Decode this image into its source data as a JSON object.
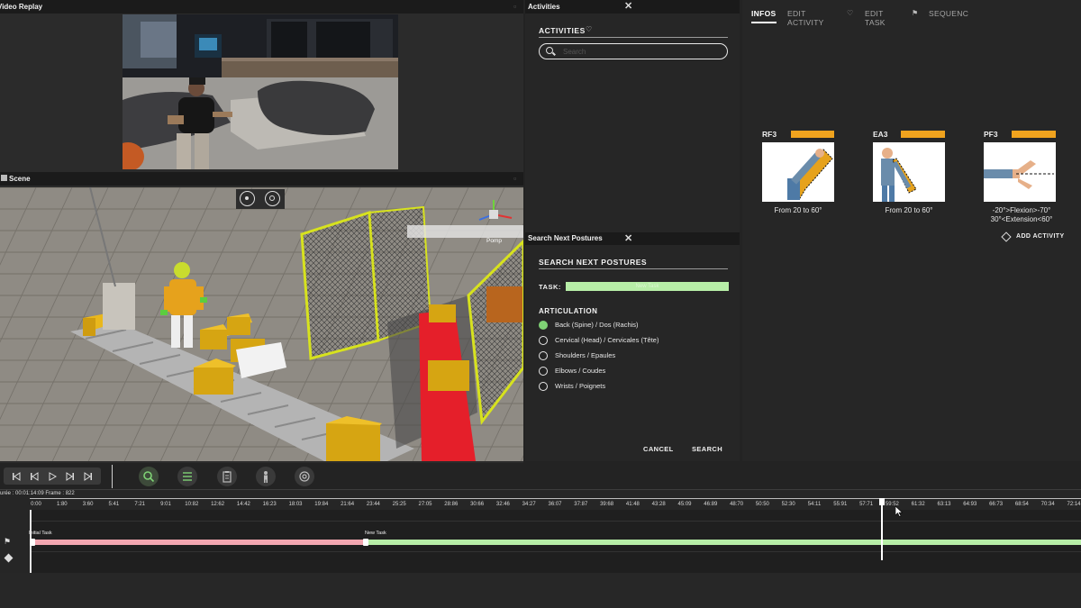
{
  "video_replay": {
    "title": "Video Replay"
  },
  "scene": {
    "title": "Scene",
    "label_pomp": "Pomp"
  },
  "activities": {
    "title": "Activities",
    "heading": "ACTIVITIES",
    "search_placeholder": "Search"
  },
  "infos": {
    "tabs": [
      {
        "label": "INFOS"
      },
      {
        "label": "EDIT ACTIVITY"
      },
      {
        "label": "EDIT TASK"
      },
      {
        "label": "SEQUENC"
      }
    ],
    "cards": [
      {
        "code": "RF3",
        "range_line1": "From 20 to 60°",
        "range_line2": ""
      },
      {
        "code": "EA3",
        "range_line1": "From 20 to 60°",
        "range_line2": ""
      },
      {
        "code": "PF3",
        "range_line1": "-20°>Flexion>-70°",
        "range_line2": "30°<Extension<60°"
      }
    ],
    "add_activity": "ADD ACTIVITY"
  },
  "search_postures": {
    "title": "Search Next Postures",
    "heading": "SEARCH NEXT POSTURES",
    "task_label": "TASK:",
    "task_value": "New Task",
    "articulation_heading": "ARTICULATION",
    "articulations": [
      {
        "label": "Back (Spine) / Dos (Rachis)",
        "selected": true
      },
      {
        "label": "Cervical (Head) / Cervicales (Tête)",
        "selected": false
      },
      {
        "label": "Shoulders / Epaules",
        "selected": false
      },
      {
        "label": "Elbows / Coudes",
        "selected": false
      },
      {
        "label": "Wrists / Poignets",
        "selected": false
      }
    ],
    "cancel": "CANCEL",
    "search": "SEARCH"
  },
  "timeline": {
    "time_info": "urée : 00:01:14:09   Frame : 822",
    "ticks": [
      "0:00",
      "1:80",
      "3:60",
      "5:41",
      "7:21",
      "9:01",
      "10:82",
      "12:62",
      "14:42",
      "16:23",
      "18:03",
      "19:84",
      "21:64",
      "23:44",
      "25:25",
      "27:05",
      "28:86",
      "30:66",
      "32:46",
      "34:27",
      "36:07",
      "37:87",
      "39:68",
      "41:48",
      "43:28",
      "45:09",
      "46:89",
      "48:70",
      "50:50",
      "52:30",
      "54:11",
      "55:91",
      "57:71",
      "59:52",
      "61:32",
      "63:13",
      "64:93",
      "66:73",
      "68:54",
      "70:34",
      "72:14"
    ],
    "task_labels": [
      "Initial Task",
      "New Task"
    ],
    "playhead_fraction": 0.81
  },
  "colors": {
    "accent_orange": "#f0a31e",
    "task_green": "#b7eea7",
    "task_pink": "#f2a6b0",
    "selected_green": "#7fd275"
  }
}
